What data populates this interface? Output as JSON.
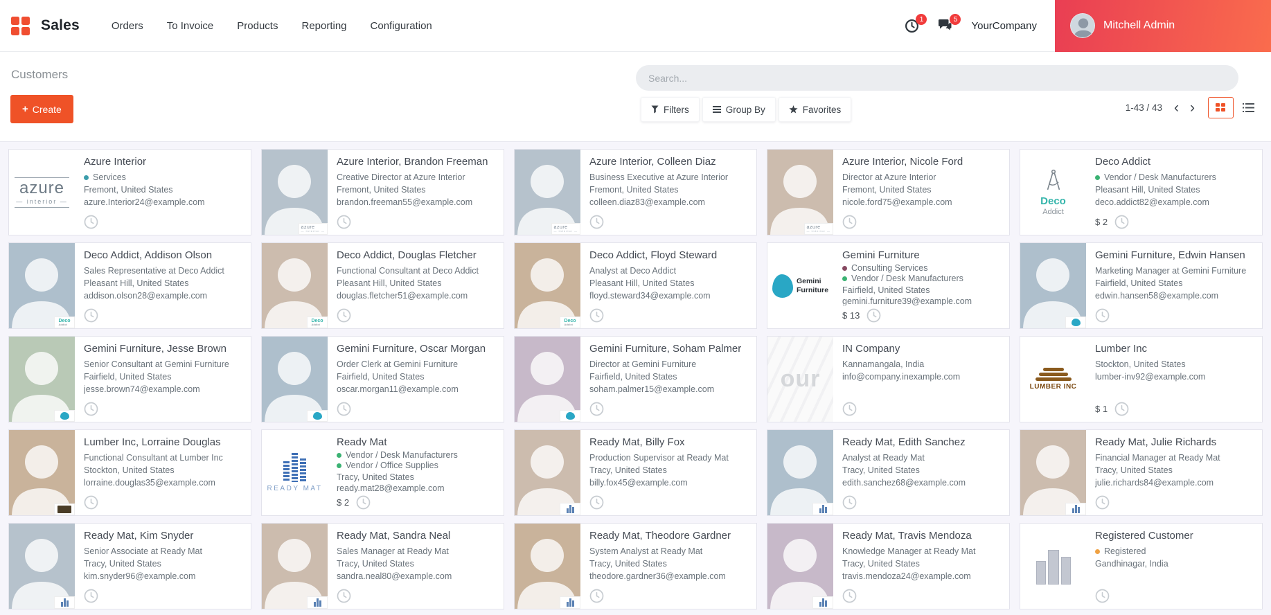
{
  "nav": {
    "app_name": "Sales",
    "menu_items": [
      "Orders",
      "To Invoice",
      "Products",
      "Reporting",
      "Configuration"
    ],
    "activity_badge": "1",
    "messages_badge": "5",
    "company_name": "YourCompany",
    "user_name": "Mitchell Admin"
  },
  "control_panel": {
    "breadcrumb": "Customers",
    "create_label": "Create",
    "search_placeholder": "Search...",
    "filters_label": "Filters",
    "group_by_label": "Group By",
    "favorites_label": "Favorites",
    "pager": "1-43 / 43",
    "prev_arrow": "‹",
    "next_arrow": "›"
  },
  "colors": {
    "accent": "#ef5227",
    "app_icon": "#f04e31",
    "badge_red": "#f13b3b",
    "user_gradient_start": "#e93e53",
    "user_gradient_end": "#fa6c4d",
    "tag_services": "#3c9dab",
    "tag_vendor_green": "#3bb273",
    "tag_consulting": "#874a62",
    "tag_registered": "#efa143"
  },
  "cards": [
    {
      "image": "logo-azure",
      "title": "Azure Interior",
      "tags": [
        {
          "label": "Services",
          "color": "#3c9dab"
        }
      ],
      "location": "Fremont, United States",
      "email": "azure.Interior24@example.com",
      "amount": null,
      "badge": null
    },
    {
      "image": "photo",
      "title": "Azure Interior, Brandon Freeman",
      "subtitle": "Creative Director at Azure Interior",
      "location": "Fremont, United States",
      "email": "brandon.freeman55@example.com",
      "amount": null,
      "badge": "azure"
    },
    {
      "image": "photo",
      "title": "Azure Interior, Colleen Diaz",
      "subtitle": "Business Executive at Azure Interior",
      "location": "Fremont, United States",
      "email": "colleen.diaz83@example.com",
      "amount": null,
      "badge": "azure"
    },
    {
      "image": "photo",
      "title": "Azure Interior, Nicole Ford",
      "subtitle": "Director at Azure Interior",
      "location": "Fremont, United States",
      "email": "nicole.ford75@example.com",
      "amount": null,
      "badge": "azure"
    },
    {
      "image": "logo-deco",
      "title": "Deco Addict",
      "tags": [
        {
          "label": "Vendor / Desk Manufacturers",
          "color": "#3bb273"
        }
      ],
      "location": "Pleasant Hill, United States",
      "email": "deco.addict82@example.com",
      "amount": "$ 2",
      "badge": null
    },
    {
      "image": "photo",
      "title": "Deco Addict, Addison Olson",
      "subtitle": "Sales Representative at Deco Addict",
      "location": "Pleasant Hill, United States",
      "email": "addison.olson28@example.com",
      "amount": null,
      "badge": "deco"
    },
    {
      "image": "photo",
      "title": "Deco Addict, Douglas Fletcher",
      "subtitle": "Functional Consultant at Deco Addict",
      "location": "Pleasant Hill, United States",
      "email": "douglas.fletcher51@example.com",
      "amount": null,
      "badge": "deco"
    },
    {
      "image": "photo",
      "title": "Deco Addict, Floyd Steward",
      "subtitle": "Analyst at Deco Addict",
      "location": "Pleasant Hill, United States",
      "email": "floyd.steward34@example.com",
      "amount": null,
      "badge": "deco"
    },
    {
      "image": "logo-gemini",
      "title": "Gemini Furniture",
      "tags": [
        {
          "label": "Consulting Services",
          "color": "#874a62"
        },
        {
          "label": "Vendor / Desk Manufacturers",
          "color": "#3bb273"
        }
      ],
      "location": "Fairfield, United States",
      "email": "gemini.furniture39@example.com",
      "amount": "$ 13",
      "badge": null
    },
    {
      "image": "photo",
      "title": "Gemini Furniture, Edwin Hansen",
      "subtitle": "Marketing Manager at Gemini Furniture",
      "location": "Fairfield, United States",
      "email": "edwin.hansen58@example.com",
      "amount": null,
      "badge": "gemini"
    },
    {
      "image": "photo",
      "title": "Gemini Furniture, Jesse Brown",
      "subtitle": "Senior Consultant at Gemini Furniture",
      "location": "Fairfield, United States",
      "email": "jesse.brown74@example.com",
      "amount": null,
      "badge": "gemini"
    },
    {
      "image": "photo",
      "title": "Gemini Furniture, Oscar Morgan",
      "subtitle": "Order Clerk at Gemini Furniture",
      "location": "Fairfield, United States",
      "email": "oscar.morgan11@example.com",
      "amount": null,
      "badge": "gemini"
    },
    {
      "image": "photo",
      "title": "Gemini Furniture, Soham Palmer",
      "subtitle": "Director at Gemini Furniture",
      "location": "Fairfield, United States",
      "email": "soham.palmer15@example.com",
      "amount": null,
      "badge": "gemini"
    },
    {
      "image": "logo-in",
      "title": "IN Company",
      "tags": [],
      "location": "Kannamangala, India",
      "email": "info@company.inexample.com",
      "amount": null,
      "badge": null
    },
    {
      "image": "logo-lumber",
      "title": "Lumber Inc",
      "tags": [],
      "location": "Stockton, United States",
      "email": "lumber-inv92@example.com",
      "amount": "$ 1",
      "badge": null
    },
    {
      "image": "photo",
      "title": "Lumber Inc, Lorraine Douglas",
      "subtitle": "Functional Consultant at Lumber Inc",
      "location": "Stockton, United States",
      "email": "lorraine.douglas35@example.com",
      "amount": null,
      "badge": "lumber"
    },
    {
      "image": "logo-ready",
      "title": "Ready Mat",
      "tags": [
        {
          "label": "Vendor / Desk Manufacturers",
          "color": "#3bb273"
        },
        {
          "label": "Vendor / Office Supplies",
          "color": "#3bb273"
        }
      ],
      "location": "Tracy, United States",
      "email": "ready.mat28@example.com",
      "amount": "$ 2",
      "badge": null
    },
    {
      "image": "photo",
      "title": "Ready Mat, Billy Fox",
      "subtitle": "Production Supervisor at Ready Mat",
      "location": "Tracy, United States",
      "email": "billy.fox45@example.com",
      "amount": null,
      "badge": "readymat"
    },
    {
      "image": "photo",
      "title": "Ready Mat, Edith Sanchez",
      "subtitle": "Analyst at Ready Mat",
      "location": "Tracy, United States",
      "email": "edith.sanchez68@example.com",
      "amount": null,
      "badge": "readymat"
    },
    {
      "image": "photo",
      "title": "Ready Mat, Julie Richards",
      "subtitle": "Financial Manager at Ready Mat",
      "location": "Tracy, United States",
      "email": "julie.richards84@example.com",
      "amount": null,
      "badge": "readymat"
    },
    {
      "image": "photo",
      "title": "Ready Mat, Kim Snyder",
      "subtitle": "Senior Associate at Ready Mat",
      "location": "Tracy, United States",
      "email": "kim.snyder96@example.com",
      "amount": null,
      "badge": "readymat"
    },
    {
      "image": "photo",
      "title": "Ready Mat, Sandra Neal",
      "subtitle": "Sales Manager at Ready Mat",
      "location": "Tracy, United States",
      "email": "sandra.neal80@example.com",
      "amount": null,
      "badge": "readymat"
    },
    {
      "image": "photo",
      "title": "Ready Mat, Theodore Gardner",
      "subtitle": "System Analyst at Ready Mat",
      "location": "Tracy, United States",
      "email": "theodore.gardner36@example.com",
      "amount": null,
      "badge": "readymat"
    },
    {
      "image": "photo",
      "title": "Ready Mat, Travis Mendoza",
      "subtitle": "Knowledge Manager at Ready Mat",
      "location": "Tracy, United States",
      "email": "travis.mendoza24@example.com",
      "amount": null,
      "badge": "readymat"
    },
    {
      "image": "logo-city",
      "title": "Registered Customer",
      "tags": [
        {
          "label": "Registered",
          "color": "#efa143"
        }
      ],
      "location": "Gandhinagar, India",
      "email": null,
      "amount": null,
      "badge": null
    }
  ]
}
